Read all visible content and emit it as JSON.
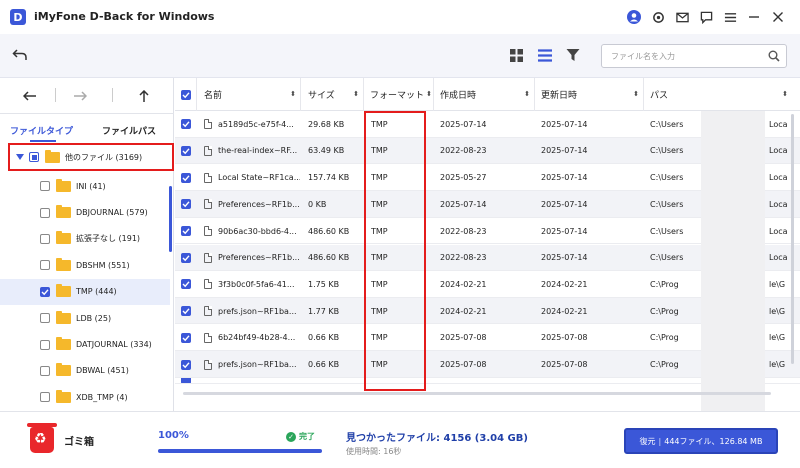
{
  "app": {
    "title": "iMyFone D-Back for Windows",
    "logo_letter": "D"
  },
  "toolbar": {
    "search_placeholder": "ファイル名を入力"
  },
  "left_panel": {
    "tabs": [
      "ファイルタイプ",
      "ファイルパス"
    ],
    "root": {
      "label": "他のファイル (3169)"
    },
    "items": [
      {
        "label": "INI (41)",
        "checked": false
      },
      {
        "label": "DBJOURNAL (579)",
        "checked": false
      },
      {
        "label": "拡張子なし (191)",
        "checked": false
      },
      {
        "label": "DBSHM (551)",
        "checked": false
      },
      {
        "label": "TMP (444)",
        "checked": true
      },
      {
        "label": "LDB (25)",
        "checked": false
      },
      {
        "label": "DATJOURNAL (334)",
        "checked": false
      },
      {
        "label": "DBWAL (451)",
        "checked": false
      },
      {
        "label": "XDB_TMP (4)",
        "checked": false
      }
    ]
  },
  "table": {
    "columns": [
      "名前",
      "サイズ",
      "フォーマット",
      "作成日時",
      "更新日時",
      "パス"
    ],
    "rows": [
      {
        "name": "a5189d5c-e75f-4...",
        "size": "29.68 KB",
        "format": "TMP",
        "created": "2025-07-14",
        "modified": "2025-07-14",
        "path": "C:\\Users",
        "path_tail": "Loca"
      },
      {
        "name": "the-real-index~RF...",
        "size": "63.49 KB",
        "format": "TMP",
        "created": "2022-08-23",
        "modified": "2025-07-14",
        "path": "C:\\Users",
        "path_tail": "Loca"
      },
      {
        "name": "Local State~RF1ca...",
        "size": "157.74 KB",
        "format": "TMP",
        "created": "2025-05-27",
        "modified": "2025-07-14",
        "path": "C:\\Users",
        "path_tail": "Loca"
      },
      {
        "name": "Preferences~RF1b...",
        "size": "0 KB",
        "format": "TMP",
        "created": "2025-07-14",
        "modified": "2025-07-14",
        "path": "C:\\Users",
        "path_tail": "Loca"
      },
      {
        "name": "90b6ac30-bbd6-4...",
        "size": "486.60 KB",
        "format": "TMP",
        "created": "2022-08-23",
        "modified": "2025-07-14",
        "path": "C:\\Users",
        "path_tail": "Loca"
      },
      {
        "name": "Preferences~RF1b...",
        "size": "486.60 KB",
        "format": "TMP",
        "created": "2022-08-23",
        "modified": "2025-07-14",
        "path": "C:\\Users",
        "path_tail": "Loca"
      },
      {
        "name": "3f3b0c0f-5fa6-41...",
        "size": "1.75 KB",
        "format": "TMP",
        "created": "2024-02-21",
        "modified": "2024-02-21",
        "path": "C:\\Prog",
        "path_tail": "le\\G"
      },
      {
        "name": "prefs.json~RF1ba...",
        "size": "1.77 KB",
        "format": "TMP",
        "created": "2024-02-21",
        "modified": "2024-02-21",
        "path": "C:\\Prog",
        "path_tail": "le\\G"
      },
      {
        "name": "6b24bf49-4b28-4...",
        "size": "0.66 KB",
        "format": "TMP",
        "created": "2025-07-08",
        "modified": "2025-07-08",
        "path": "C:\\Prog",
        "path_tail": "le\\G"
      },
      {
        "name": "prefs.json~RF1ba...",
        "size": "0.66 KB",
        "format": "TMP",
        "created": "2025-07-08",
        "modified": "2025-07-08",
        "path": "C:\\Prog",
        "path_tail": "le\\G"
      }
    ]
  },
  "bottom": {
    "trash_label": "ゴミ箱",
    "progress_text": "100%",
    "progress_value": 1.0,
    "done_label": "完了",
    "found_text": "見つかったファイル: 4156 (3.04 GB)",
    "elapsed_text": "使用時間: 16秒",
    "restore_label": "復元",
    "restore_detail": "444ファイル、126.84 MB"
  },
  "colors": {
    "accent": "#3b57d8",
    "highlight": "#e41c1c",
    "folder": "#f5b82b",
    "trash": "#e9272b",
    "success": "#2aa55a"
  }
}
